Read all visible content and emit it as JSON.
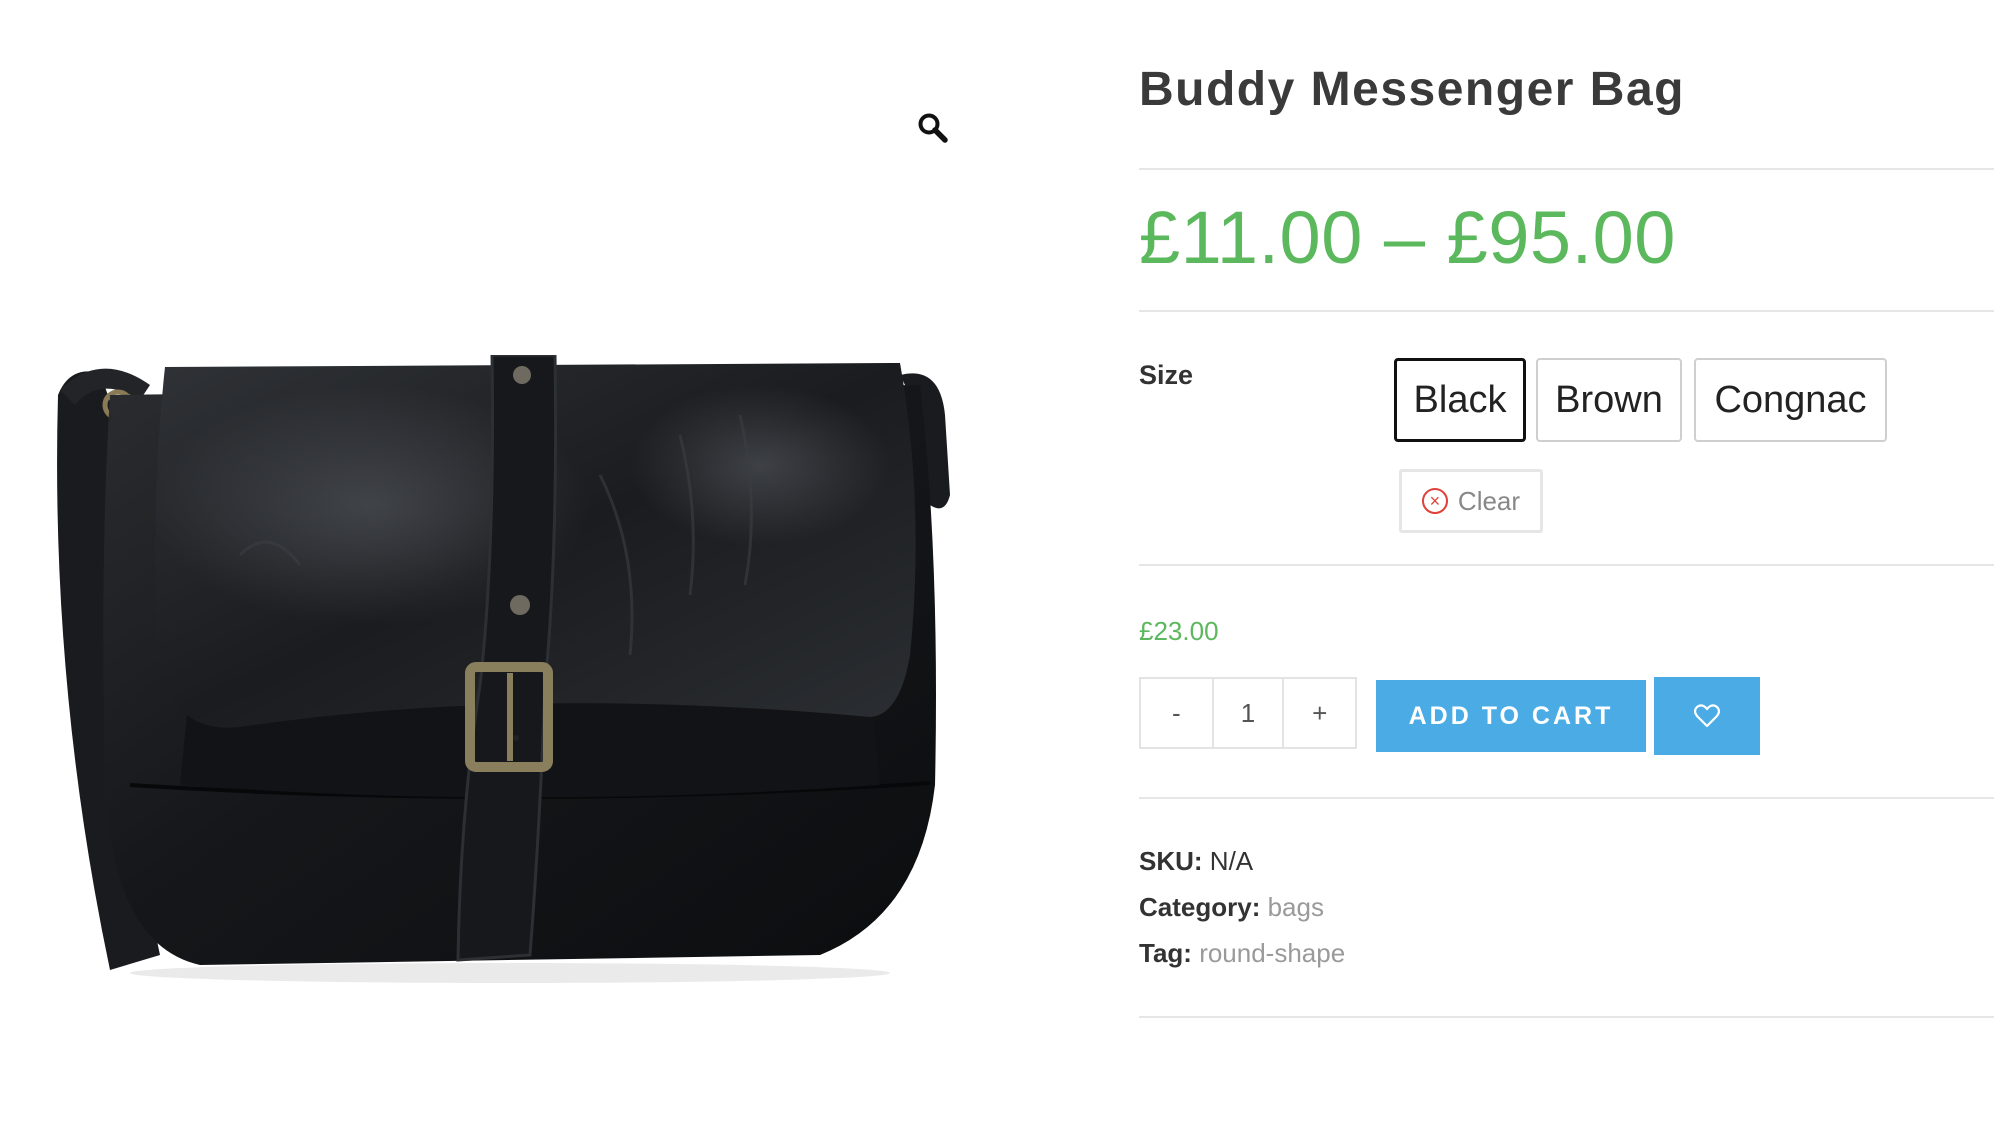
{
  "product": {
    "title": "Buddy Messenger Bag",
    "price_range": "£11.00 – £95.00",
    "image_alt_icon": "magnifier-icon"
  },
  "variations": {
    "label": "Size",
    "options": [
      "Black",
      "Brown",
      "Congnac"
    ],
    "selected": "Black",
    "clear_label": "Clear"
  },
  "variation_price": "£23.00",
  "cart": {
    "quantity_minus": "-",
    "quantity_value": "1",
    "quantity_plus": "+",
    "add_to_cart_label": "ADD TO CART",
    "wishlist_icon": "heart-icon"
  },
  "meta": {
    "sku_label": "SKU:",
    "sku_value": "N/A",
    "category_label": "Category:",
    "category_value": "bags",
    "tag_label": "Tag:",
    "tag_value": "round-shape"
  },
  "colors": {
    "price_green": "#5cb85c",
    "button_blue": "#4aabe5",
    "clear_red": "#e0413a"
  }
}
